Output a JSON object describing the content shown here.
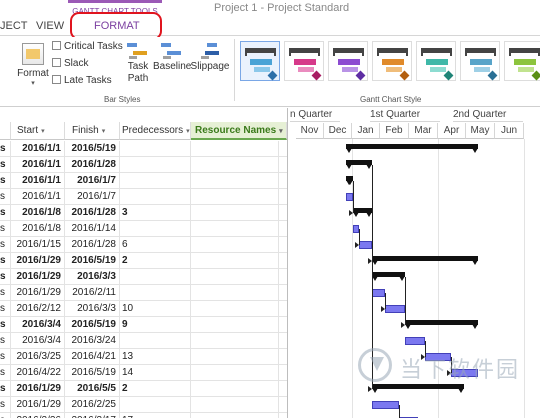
{
  "context_tab": "GANTT CHART TOOLS",
  "document_title": "Project 1 - Project Standard",
  "tabs": {
    "project": "JECT",
    "view": "VIEW",
    "format": "FORMAT"
  },
  "ribbon": {
    "format_label": "Format",
    "checkboxes": [
      "Critical Tasks",
      "Slack",
      "Late Tasks"
    ],
    "task_path_label": "Task Path",
    "baseline_label": "Baseline",
    "slippage_label": "Slippage",
    "bar_styles_group": "Bar Styles",
    "gantt_style_group": "Gantt Chart Style",
    "gallery_colors": [
      {
        "mid": "#4aa3d6",
        "bot": "#8cc8ea",
        "dia": "#2d6fa8"
      },
      {
        "mid": "#d6398a",
        "bot": "#ea8cbf",
        "dia": "#a81d62"
      },
      {
        "mid": "#8c4bd1",
        "bot": "#b993e6",
        "dia": "#5e2ea3"
      },
      {
        "mid": "#e08a2a",
        "bot": "#f0bd7a",
        "dia": "#b35f0e"
      },
      {
        "mid": "#3fb8a8",
        "bot": "#8ddcd1",
        "dia": "#1f8477"
      },
      {
        "mid": "#58a4c9",
        "bot": "#9fd0e6",
        "dia": "#2a6f94"
      },
      {
        "mid": "#8cc43d",
        "bot": "#c1e38f",
        "dia": "#5a8f14"
      }
    ]
  },
  "columns": {
    "start": "Start",
    "finish": "Finish",
    "predecessors": "Predecessors",
    "resource_names": "Resource Names"
  },
  "rows": [
    {
      "id": "s",
      "start": "2016/1/1",
      "finish": "2016/5/19",
      "pred": "",
      "bold": true
    },
    {
      "id": "s",
      "start": "2016/1/1",
      "finish": "2016/1/28",
      "pred": "",
      "bold": true
    },
    {
      "id": "s",
      "start": "2016/1/1",
      "finish": "2016/1/7",
      "pred": "",
      "bold": true
    },
    {
      "id": "s",
      "start": "2016/1/1",
      "finish": "2016/1/7",
      "pred": "",
      "bold": false
    },
    {
      "id": "s",
      "start": "2016/1/8",
      "finish": "2016/1/28",
      "pred": "3",
      "bold": true
    },
    {
      "id": "s",
      "start": "2016/1/8",
      "finish": "2016/1/14",
      "pred": "",
      "bold": false
    },
    {
      "id": "s",
      "start": "2016/1/15",
      "finish": "2016/1/28",
      "pred": "6",
      "bold": false
    },
    {
      "id": "s",
      "start": "2016/1/29",
      "finish": "2016/5/19",
      "pred": "2",
      "bold": true
    },
    {
      "id": "s",
      "start": "2016/1/29",
      "finish": "2016/3/3",
      "pred": "",
      "bold": true
    },
    {
      "id": "s",
      "start": "2016/1/29",
      "finish": "2016/2/11",
      "pred": "",
      "bold": false
    },
    {
      "id": "s",
      "start": "2016/2/12",
      "finish": "2016/3/3",
      "pred": "10",
      "bold": false
    },
    {
      "id": "s",
      "start": "2016/3/4",
      "finish": "2016/5/19",
      "pred": "9",
      "bold": true
    },
    {
      "id": "s",
      "start": "2016/3/4",
      "finish": "2016/3/24",
      "pred": "",
      "bold": false
    },
    {
      "id": "s",
      "start": "2016/3/25",
      "finish": "2016/4/21",
      "pred": "13",
      "bold": false
    },
    {
      "id": "s",
      "start": "2016/4/22",
      "finish": "2016/5/19",
      "pred": "14",
      "bold": false
    },
    {
      "id": "s",
      "start": "2016/1/29",
      "finish": "2016/5/5",
      "pred": "2",
      "bold": true
    },
    {
      "id": "s",
      "start": "2016/1/29",
      "finish": "2016/2/25",
      "pred": "",
      "bold": false
    },
    {
      "id": "s",
      "start": "2016/2/26",
      "finish": "2016/3/17",
      "pred": "17",
      "bold": false
    }
  ],
  "timeline": {
    "quarters": [
      "n Quarter",
      "1st Quarter",
      "2nd Quarter"
    ],
    "months": [
      "Nov",
      "Dec",
      "Jan",
      "Feb",
      "Mar",
      "Apr",
      "May",
      "Jun"
    ]
  },
  "watermark": "当下软件园"
}
